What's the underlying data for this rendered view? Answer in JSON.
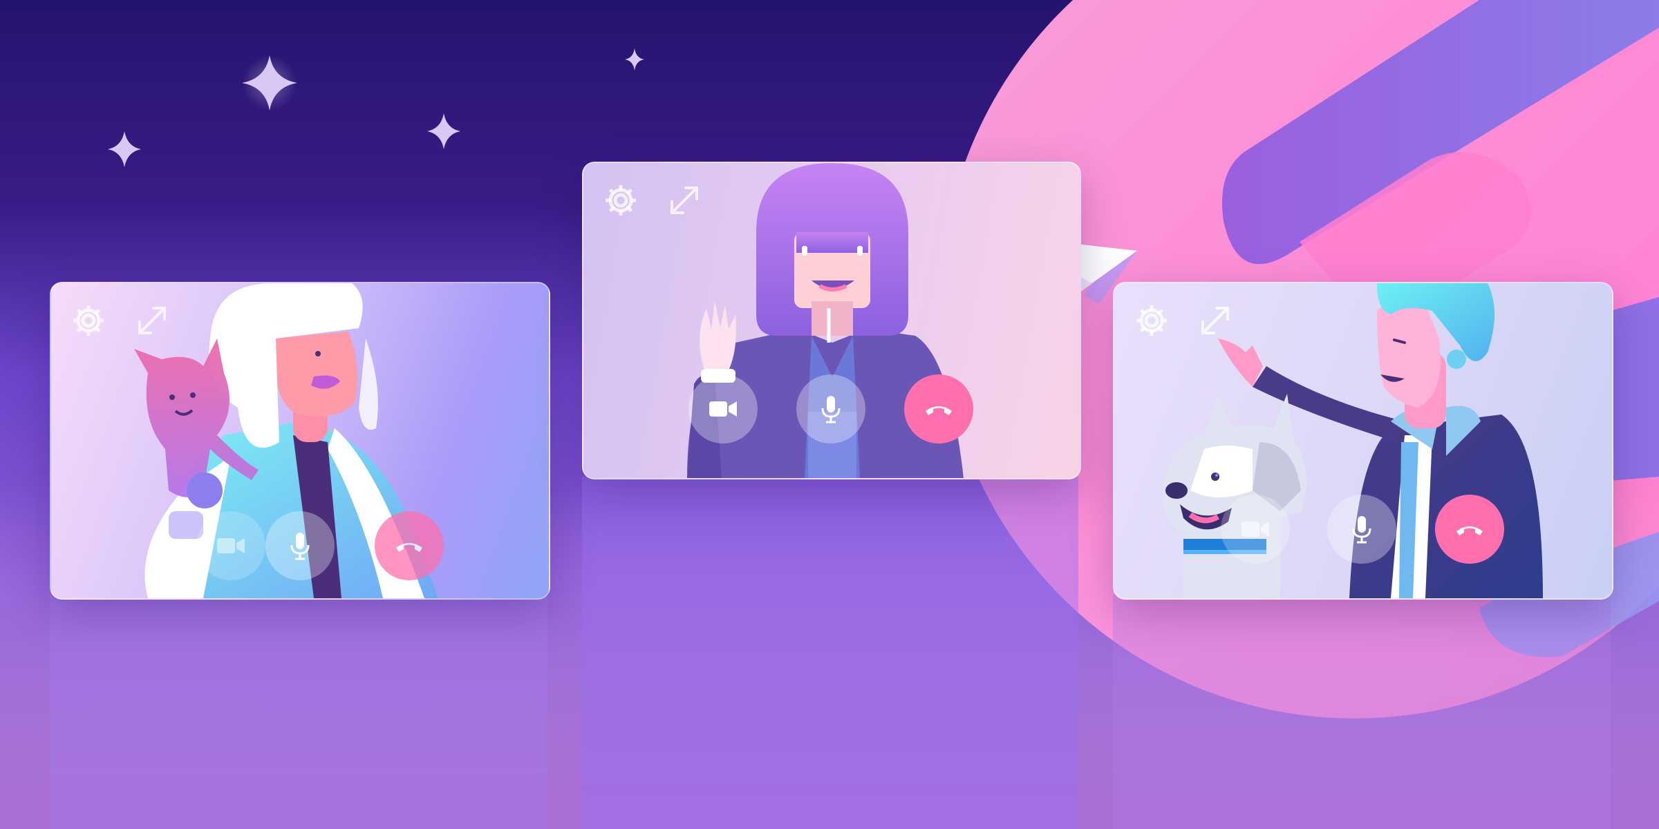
{
  "theme": {
    "accent": "#b98cf7",
    "end_call_color": "#ff6fae",
    "background_top": "#24146e",
    "background_bottom": "#9b5cc4"
  },
  "decor": {
    "sparkle_icon": "four-point-star",
    "paper_plane_icon": "paper-plane"
  },
  "video_calls": [
    {
      "participant": "woman-with-cat",
      "toolbar_icons": [
        "gear-icon",
        "expand-icon"
      ],
      "controls": [
        "camera-icon",
        "microphone-icon",
        "hang-up-icon"
      ]
    },
    {
      "participant": "waving-woman",
      "toolbar_icons": [
        "gear-icon",
        "expand-icon"
      ],
      "controls": [
        "camera-icon",
        "microphone-icon",
        "hang-up-icon"
      ]
    },
    {
      "participant": "man-with-dog",
      "toolbar_icons": [
        "gear-icon",
        "expand-icon"
      ],
      "controls": [
        "camera-icon",
        "microphone-icon",
        "hang-up-icon"
      ]
    }
  ]
}
